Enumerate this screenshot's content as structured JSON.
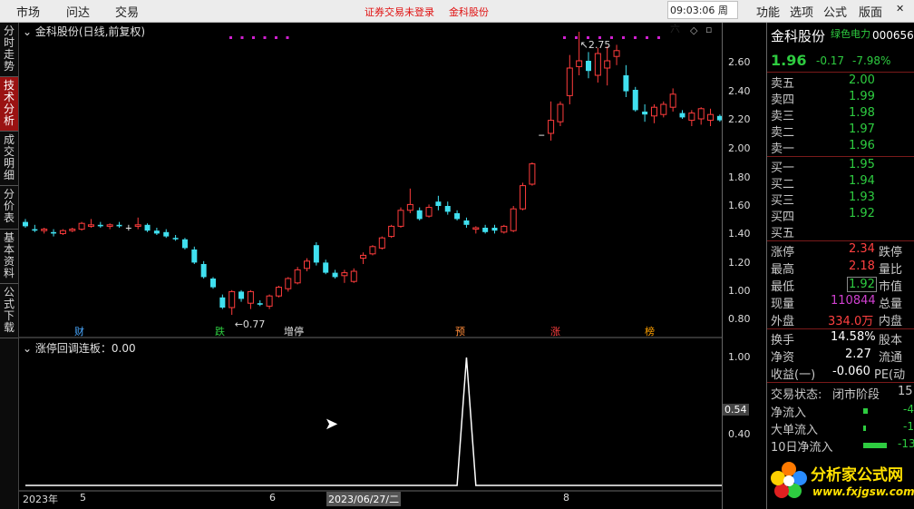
{
  "topbar": {
    "menu": [
      "市场",
      "问达",
      "交易"
    ],
    "notice": "证券交易未登录",
    "stock": "金科股份",
    "time": "09:03:06 周六",
    "right_menu": [
      "功能",
      "选项",
      "公式",
      "版面"
    ]
  },
  "left_tabs": [
    "分时走势",
    "技术分析",
    "成交明细",
    "分价表",
    "基本资料",
    "公式下载"
  ],
  "chart": {
    "title": "金科股份(日线,前复权)",
    "indicator_title": "涨停回调连板：0.00",
    "hi_label": "2.75",
    "lo_label": "0.77",
    "price_axis": [
      "2.60",
      "2.40",
      "2.20",
      "2.00",
      "1.80",
      "1.60",
      "1.40",
      "1.20",
      "1.00",
      "0.80"
    ],
    "ind_axis": [
      "1.00",
      "0.54",
      "0.40"
    ],
    "events": [
      {
        "t": "财",
        "color": "#4aa8ff"
      },
      {
        "t": "跌",
        "color": "#2ecc40"
      },
      {
        "t": "增停",
        "color": "#e0e0e0"
      },
      {
        "t": "预",
        "color": "#ff8c3a"
      },
      {
        "t": "涨",
        "color": "#ff4040"
      },
      {
        "t": "榜",
        "color": "#ffa000"
      }
    ],
    "x_axis": [
      "2023年",
      "5",
      "6",
      "2023/06/27/二",
      "8"
    ]
  },
  "chart_data": {
    "type": "candlestick",
    "y_unit": "price (CNY)",
    "ylim": [
      0.75,
      2.75
    ],
    "highest": 2.75,
    "lowest": 0.77,
    "ohlc": [
      [
        1.44,
        1.46,
        1.4,
        1.41
      ],
      [
        1.39,
        1.42,
        1.37,
        1.38
      ],
      [
        1.38,
        1.4,
        1.36,
        1.39
      ],
      [
        1.37,
        1.39,
        1.34,
        1.36
      ],
      [
        1.36,
        1.39,
        1.35,
        1.38
      ],
      [
        1.38,
        1.4,
        1.37,
        1.39
      ],
      [
        1.39,
        1.44,
        1.38,
        1.43
      ],
      [
        1.41,
        1.46,
        1.4,
        1.42
      ],
      [
        1.42,
        1.44,
        1.4,
        1.41
      ],
      [
        1.41,
        1.43,
        1.39,
        1.42
      ],
      [
        1.42,
        1.44,
        1.4,
        1.41
      ],
      [
        1.4,
        1.42,
        1.38,
        1.4
      ],
      [
        1.41,
        1.47,
        1.39,
        1.42
      ],
      [
        1.42,
        1.43,
        1.37,
        1.38
      ],
      [
        1.38,
        1.4,
        1.35,
        1.36
      ],
      [
        1.37,
        1.39,
        1.33,
        1.34
      ],
      [
        1.33,
        1.35,
        1.31,
        1.32
      ],
      [
        1.32,
        1.33,
        1.25,
        1.26
      ],
      [
        1.25,
        1.27,
        1.15,
        1.16
      ],
      [
        1.15,
        1.17,
        1.05,
        1.06
      ],
      [
        1.05,
        1.06,
        0.98,
        0.99
      ],
      [
        0.92,
        0.94,
        0.84,
        0.85
      ],
      [
        0.85,
        0.97,
        0.8,
        0.96
      ],
      [
        0.96,
        0.97,
        0.89,
        0.91
      ],
      [
        0.88,
        0.97,
        0.84,
        0.96
      ],
      [
        0.88,
        0.9,
        0.86,
        0.87
      ],
      [
        0.86,
        0.94,
        0.84,
        0.93
      ],
      [
        0.93,
        1.0,
        0.92,
        0.99
      ],
      [
        0.98,
        1.06,
        0.96,
        1.05
      ],
      [
        1.02,
        1.13,
        1.01,
        1.11
      ],
      [
        1.12,
        1.19,
        1.1,
        1.17
      ],
      [
        1.28,
        1.3,
        1.14,
        1.16
      ],
      [
        1.16,
        1.18,
        1.08,
        1.09
      ],
      [
        1.09,
        1.11,
        1.05,
        1.06
      ],
      [
        1.07,
        1.11,
        1.02,
        1.09
      ],
      [
        1.03,
        1.12,
        1.02,
        1.1
      ],
      [
        1.19,
        1.23,
        1.15,
        1.21
      ],
      [
        1.22,
        1.28,
        1.21,
        1.27
      ],
      [
        1.26,
        1.34,
        1.25,
        1.33
      ],
      [
        1.34,
        1.42,
        1.33,
        1.41
      ],
      [
        1.41,
        1.54,
        1.4,
        1.52
      ],
      [
        1.52,
        1.67,
        1.5,
        1.56
      ],
      [
        1.52,
        1.54,
        1.45,
        1.46
      ],
      [
        1.48,
        1.56,
        1.47,
        1.54
      ],
      [
        1.58,
        1.62,
        1.52,
        1.55
      ],
      [
        1.55,
        1.58,
        1.49,
        1.51
      ],
      [
        1.5,
        1.52,
        1.45,
        1.46
      ],
      [
        1.45,
        1.47,
        1.4,
        1.42
      ],
      [
        1.39,
        1.41,
        1.36,
        1.4
      ],
      [
        1.4,
        1.42,
        1.36,
        1.37
      ],
      [
        1.4,
        1.42,
        1.36,
        1.38
      ],
      [
        1.37,
        1.42,
        1.36,
        1.41
      ],
      [
        1.38,
        1.55,
        1.37,
        1.53
      ],
      [
        1.53,
        1.71,
        1.52,
        1.69
      ],
      [
        1.7,
        1.85,
        1.69,
        1.84
      ],
      [
        2.04,
        2.04,
        2.04,
        2.04
      ],
      [
        2.05,
        2.27,
        2.0,
        2.14
      ],
      [
        2.13,
        2.27,
        2.1,
        2.25
      ],
      [
        2.31,
        2.59,
        2.25,
        2.5
      ],
      [
        2.51,
        2.75,
        2.45,
        2.55
      ],
      [
        2.55,
        2.61,
        2.43,
        2.48
      ],
      [
        2.45,
        2.64,
        2.4,
        2.6
      ],
      [
        2.5,
        2.65,
        2.38,
        2.55
      ],
      [
        2.58,
        2.66,
        2.52,
        2.62
      ],
      [
        2.45,
        2.52,
        2.3,
        2.34
      ],
      [
        2.35,
        2.37,
        2.2,
        2.21
      ],
      [
        2.2,
        2.25,
        2.13,
        2.18
      ],
      [
        2.17,
        2.25,
        2.12,
        2.23
      ],
      [
        2.18,
        2.27,
        2.16,
        2.25
      ],
      [
        2.23,
        2.36,
        2.2,
        2.32
      ],
      [
        2.19,
        2.21,
        2.15,
        2.16
      ],
      [
        2.14,
        2.21,
        2.1,
        2.19
      ],
      [
        2.15,
        2.23,
        2.11,
        2.22
      ],
      [
        2.14,
        2.22,
        2.1,
        2.18
      ],
      [
        2.17,
        2.18,
        2.13,
        2.14
      ],
      [
        2.13,
        2.15,
        1.92,
        1.96
      ]
    ],
    "series": [
      {
        "name": "涨停回调连板",
        "values": [
          0,
          0,
          0,
          0,
          0,
          0,
          0,
          0,
          0,
          0,
          0,
          0,
          0,
          0,
          0,
          0,
          0,
          0,
          0,
          0,
          0,
          0,
          0,
          0,
          0,
          0,
          0,
          0,
          0,
          0,
          0,
          0,
          0,
          0,
          0,
          0,
          0,
          0,
          0,
          0,
          0,
          0,
          0,
          0,
          0,
          0,
          0,
          1,
          0,
          0,
          0,
          0,
          0,
          0,
          0,
          0,
          0,
          0,
          0,
          0,
          0,
          0,
          0,
          0,
          0,
          0,
          0,
          0,
          0,
          0,
          0,
          0,
          0,
          0,
          0,
          0
        ]
      }
    ]
  },
  "quote": {
    "name": "金科股份",
    "tag": "绿色电力",
    "code": "000656",
    "price": "1.96",
    "change": "-0.17",
    "pct": "-7.98%",
    "asks": [
      {
        "label": "卖五",
        "price": "2.00"
      },
      {
        "label": "卖四",
        "price": "1.99"
      },
      {
        "label": "卖三",
        "price": "1.98"
      },
      {
        "label": "卖二",
        "price": "1.97"
      },
      {
        "label": "卖一",
        "price": "1.96"
      }
    ],
    "bids": [
      {
        "label": "买一",
        "price": "1.95"
      },
      {
        "label": "买二",
        "price": "1.94"
      },
      {
        "label": "买三",
        "price": "1.93"
      },
      {
        "label": "买四",
        "price": "1.92"
      },
      {
        "label": "买五",
        "price": ""
      }
    ],
    "stats": [
      {
        "l": "涨停",
        "v": "2.34",
        "l2": "跌停"
      },
      {
        "l": "最高",
        "v": "2.18",
        "l2": "量比"
      },
      {
        "l": "最低",
        "v": "1.92",
        "l2": "市值"
      },
      {
        "l": "现量",
        "v": "110844",
        "l2": "总量"
      },
      {
        "l": "外盘",
        "v": "334.0万",
        "l2": "内盘"
      }
    ],
    "stats2": [
      {
        "l": "换手",
        "v": "14.58%",
        "l2": "股本"
      },
      {
        "l": "净资",
        "v": "2.27",
        "l2": "流通"
      },
      {
        "l": "收益(一)",
        "v": "-0.060",
        "l2": "PE(动"
      }
    ],
    "trade_state_label": "交易状态:",
    "trade_state_value": "闭市阶段",
    "trade_state_num": "15",
    "flows": [
      {
        "l": "净流入",
        "v": "-4"
      },
      {
        "l": "大单流入",
        "v": "-1"
      },
      {
        "l": "10日净流入",
        "v": "-13"
      }
    ]
  },
  "watermark": {
    "brand": "分析家公式网",
    "url": "www.fxjgsw.com"
  }
}
